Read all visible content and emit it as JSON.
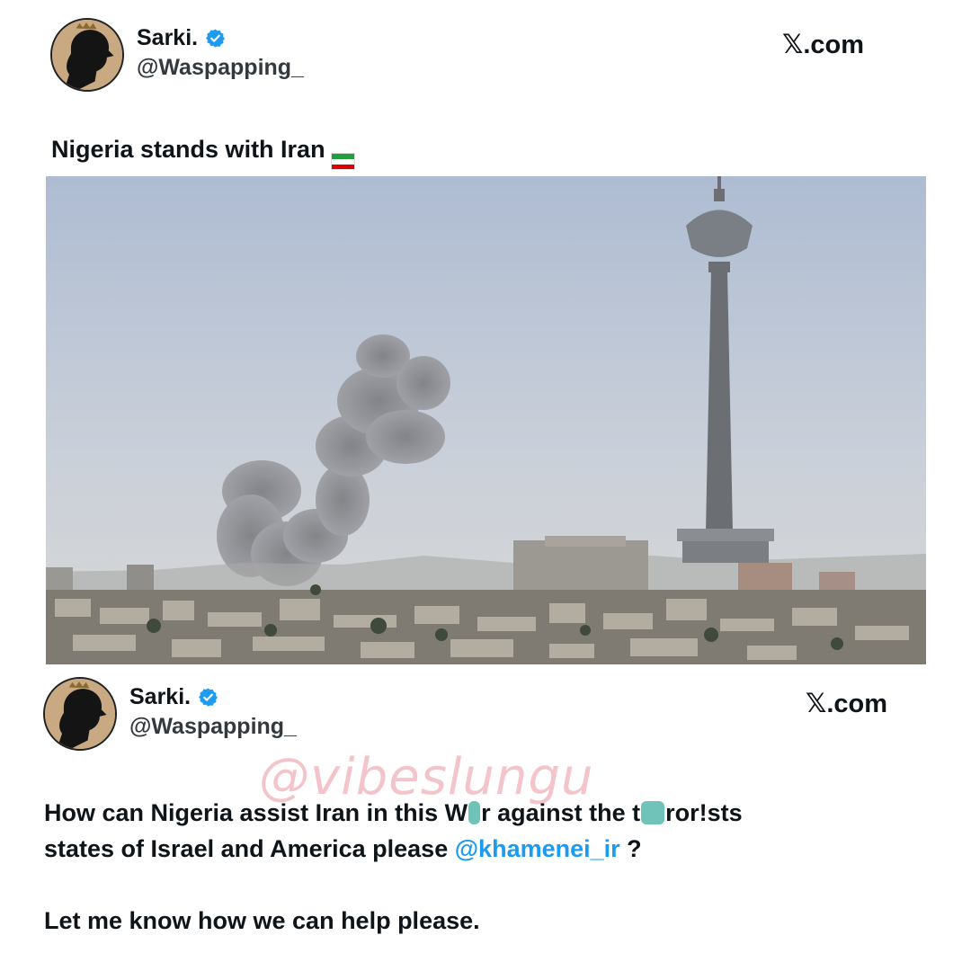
{
  "top_tweet": {
    "display_name": "Sarki.",
    "handle": "@Waspapping_",
    "site": "𝕏.com",
    "text": "Nigeria stands with Iran",
    "flag_colors": [
      "#239f40",
      "#ffffff",
      "#da0000"
    ]
  },
  "bottom_tweet": {
    "display_name": "Sarki.",
    "handle": "@Waspapping_",
    "site": "𝕏.com",
    "line1_a": "How can Nigeria assist Iran in this W",
    "line1_b": "r against the t",
    "line1_c": "ror!sts",
    "line2_a": "states of Israel and America please ",
    "mention": "@khamenei_ir",
    "line2_b": " ?",
    "line3": "Let me know how we can help please."
  },
  "watermark": "@vibeslungu",
  "icons": {
    "verified": "verified-badge-icon",
    "avatar": "silhouette-avatar"
  },
  "colors": {
    "verified": "#1d9bf0",
    "mention": "#1d9bf0",
    "avatar_bg": "#c9a982",
    "watermark": "#e996a0"
  }
}
